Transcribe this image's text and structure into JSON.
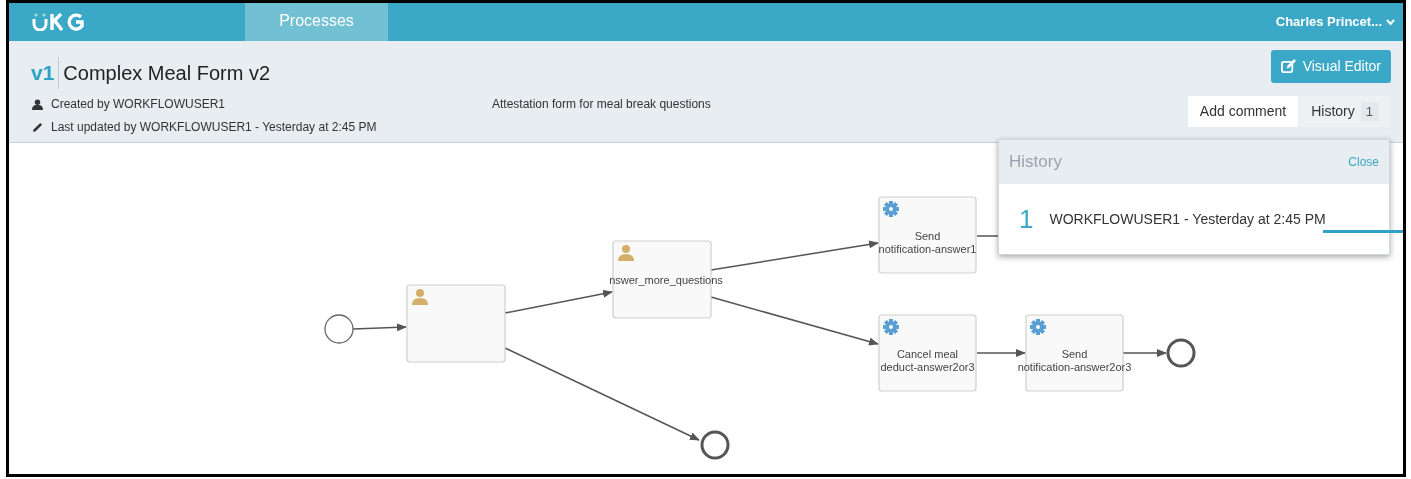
{
  "top_bar": {
    "nav_tabs": [
      {
        "label": "Processes",
        "selected": true
      }
    ],
    "user_menu": "Charles Princet..."
  },
  "header": {
    "version": "v1",
    "title": "Complex Meal Form v2",
    "created_by": "Created by WORKFLOWUSER1",
    "last_updated": "Last updated by WORKFLOWUSER1 - Yesterday at 2:45 PM",
    "description": "Attestation form for meal break questions",
    "visual_editor_button": "Visual Editor",
    "panel_tabs": [
      {
        "label": "Add comment",
        "selected": false
      },
      {
        "label": "History",
        "selected": true,
        "count": "1"
      }
    ]
  },
  "history_popup": {
    "title": "History",
    "close": "Close",
    "entries": [
      {
        "number": "1",
        "text": "WORKFLOWUSER1 - Yesterday at 2:45 PM"
      }
    ]
  },
  "diagram": {
    "nodes": [
      {
        "kind": "start"
      },
      {
        "kind": "user_task"
      },
      {
        "kind": "user_task",
        "label": [
          "nswer_more_questions"
        ]
      },
      {
        "kind": "service_task",
        "label": [
          "Send",
          "notification-answer1"
        ]
      },
      {
        "kind": "service_task",
        "label": [
          "Cancel meal",
          "deduct-answer2or3"
        ]
      },
      {
        "kind": "service_task",
        "label": [
          "Send",
          "notification-answer2or3"
        ]
      },
      {
        "kind": "end"
      },
      {
        "kind": "end"
      }
    ]
  }
}
